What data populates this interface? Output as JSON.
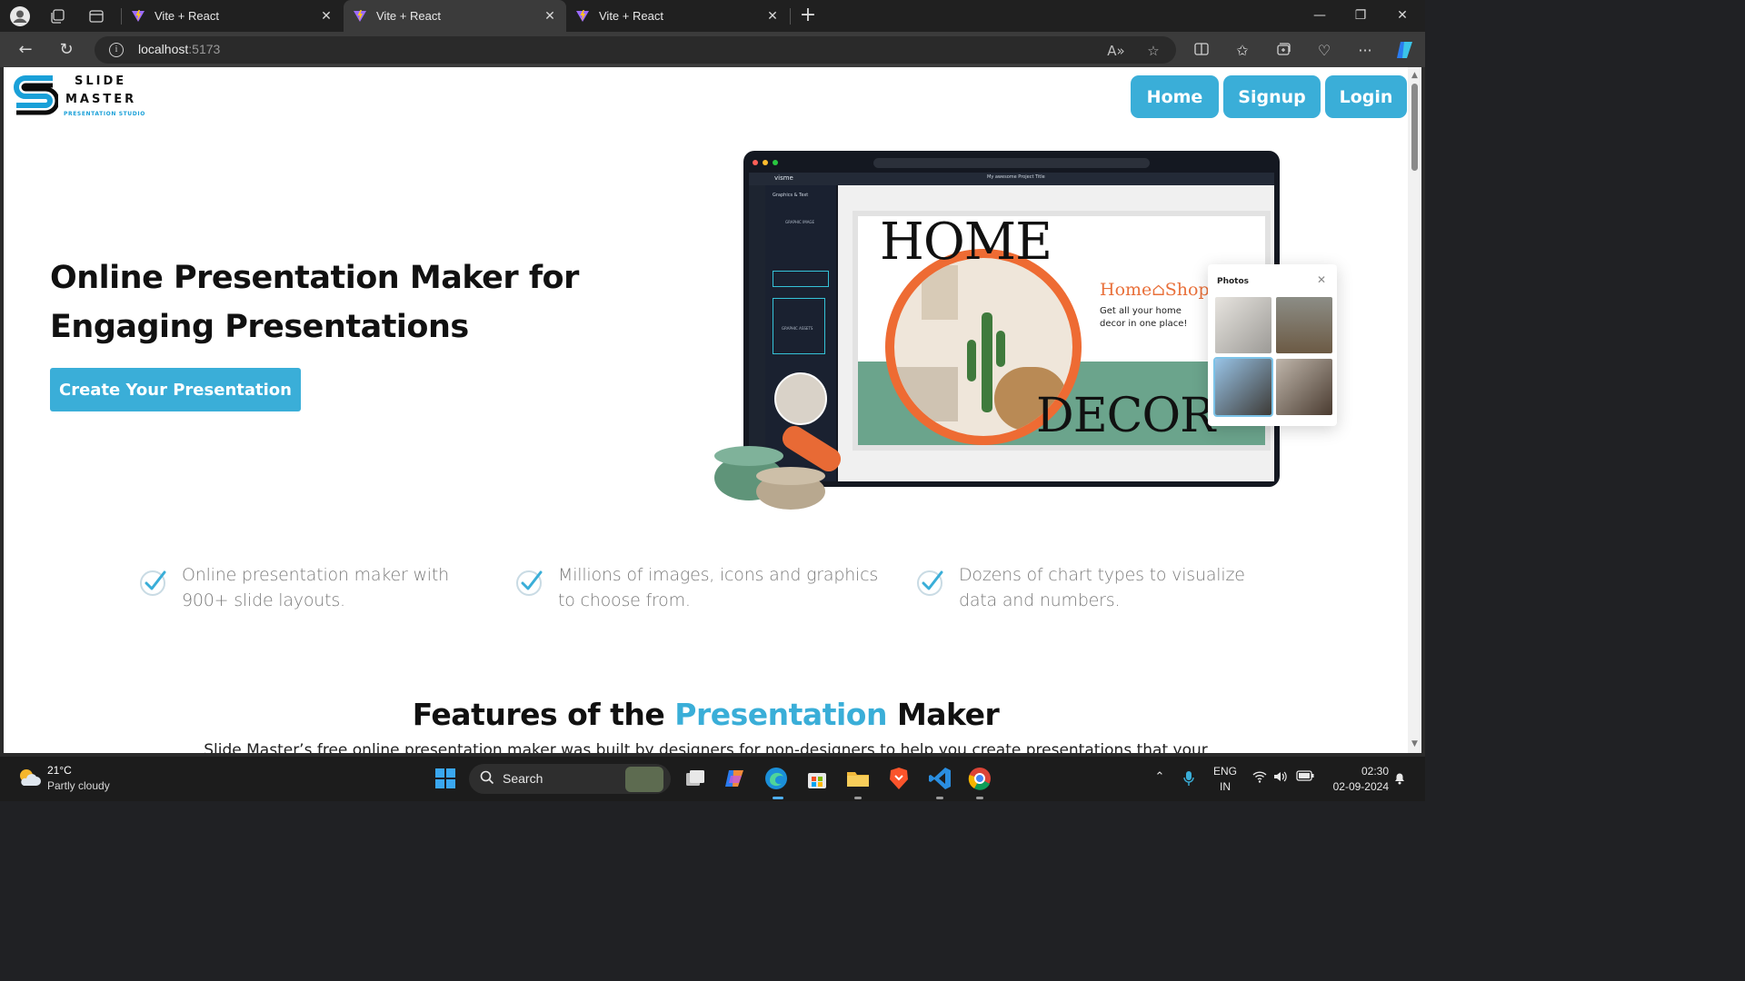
{
  "browser": {
    "tabs": [
      {
        "title": "Vite + React"
      },
      {
        "title": "Vite + React"
      },
      {
        "title": "Vite + React"
      }
    ],
    "url_host": "localhost",
    "url_port": ":5173"
  },
  "page": {
    "logo": {
      "line1": "SLIDE",
      "line2": "MASTER",
      "tagline": "PRESENTATION STUDIO"
    },
    "nav": {
      "home": "Home",
      "signup": "Signup",
      "login": "Login"
    },
    "hero": {
      "title_line1": "Online Presentation Maker for",
      "title_line2": "Engaging Presentations",
      "cta": "Create Your Presentation"
    },
    "mockup": {
      "app_brand": "visme",
      "project_title": "My awesome Project Title",
      "panel_title": "Graphics & Text",
      "panel_item": "GRAPHIC IMAGE",
      "panel_assets": "GRAPHIC ASSETS",
      "slide_home": "HOME",
      "slide_decor": "DECOR",
      "slide_shop": "Home⌂Shop",
      "slide_sub": "Get all your home decor in one place!",
      "photos_title": "Photos"
    },
    "features_list": [
      {
        "line1": "Online presentation maker with",
        "line2": "900+ slide layouts."
      },
      {
        "line1": "Millions of images, icons and graphics",
        "line2": "to choose from."
      },
      {
        "line1": "Dozens of chart types to visualize",
        "line2": "data and numbers."
      }
    ],
    "features_section": {
      "title_pre": "Features of the ",
      "title_accent": "Presentation",
      "title_post": " Maker",
      "description": "Slide Master’s free online presentation maker was built by designers for non-designers to help you create presentations that your"
    }
  },
  "taskbar": {
    "weather_temp": "21°C",
    "weather_desc": "Partly cloudy",
    "search_label": "Search",
    "lang_line1": "ENG",
    "lang_line2": "IN",
    "time": "02:30",
    "date": "02-09-2024"
  },
  "colors": {
    "accent": "#3aaed8",
    "orange": "#ee6b33",
    "sage": "#6ba48c"
  }
}
